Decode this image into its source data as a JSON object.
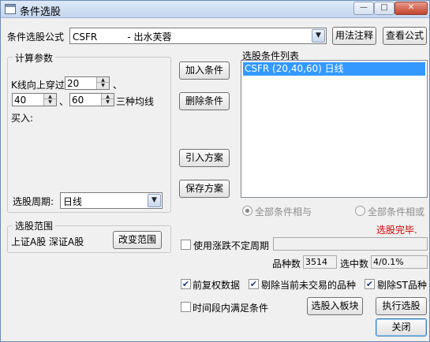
{
  "window": {
    "title": "条件选股"
  },
  "formula": {
    "label": "条件选股公式",
    "selected": "CSFR          - 出水芙蓉",
    "usage_button": "用法注释",
    "view_button": "查看公式"
  },
  "params": {
    "group_title": "计算参数",
    "line1_prefix": "K线向上穿过",
    "p1": "20",
    "sep_comma": "、",
    "p2": "40",
    "p3": "60",
    "line2_suffix": "三种均线",
    "line3": "买入:",
    "period_label": "选股周期:",
    "period_value": "日线"
  },
  "actions": {
    "add": "加入条件",
    "remove": "删除条件",
    "import": "引入方案",
    "save": "保存方案"
  },
  "conditions": {
    "title": "选股条件列表",
    "items": [
      "CSFR (20,40,60) 日线"
    ]
  },
  "logic": {
    "all_and": "全部条件相与",
    "all_or": "全部条件相或"
  },
  "status": {
    "text": "选股完毕."
  },
  "scope": {
    "group_title": "选股范围",
    "markets": "上证A股 深证A股",
    "change_button": "改变范围"
  },
  "options": {
    "use_variable_period": "使用涨跌不定周期",
    "count_label": "品种数",
    "count_value": "3514",
    "selected_label": "选中数",
    "selected_value": "4/0.1%",
    "forward_adjust": "前复权数据",
    "exclude_untraded": "剔除当前未交易的品种",
    "exclude_st": "剔除ST品种",
    "time_range": "时间段内满足条件"
  },
  "buttons": {
    "to_block": "选股入板块",
    "run": "执行选股",
    "close": "关闭"
  },
  "icons": {
    "check_mark": "✔",
    "dropdown": "▼",
    "spin_up": "▲",
    "spin_down": "▼"
  }
}
